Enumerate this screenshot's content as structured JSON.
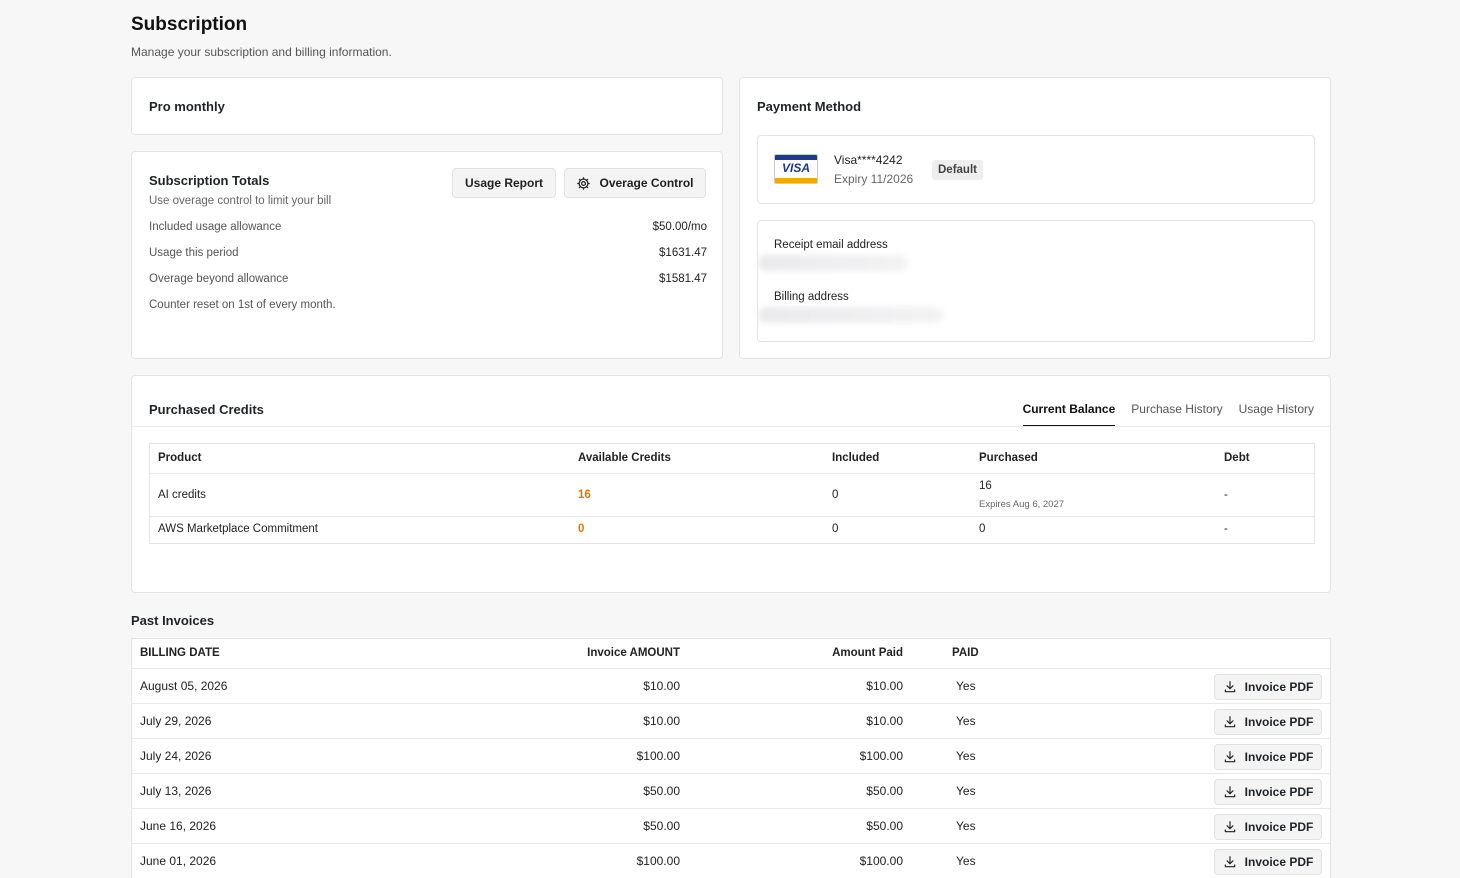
{
  "header": {
    "title": "Subscription",
    "subtitle": "Manage your subscription and billing information."
  },
  "plan": {
    "name": "Pro monthly"
  },
  "totals": {
    "title": "Subscription Totals",
    "subtitle": "Use overage control to limit your bill",
    "usage_report_label": "Usage Report",
    "overage_control_label": "Overage Control",
    "rows": [
      {
        "label": "Included usage allowance",
        "value": "$50.00/mo"
      },
      {
        "label": "Usage this period",
        "value": "$1631.47"
      },
      {
        "label": "Overage beyond allowance",
        "value": "$1581.47"
      }
    ],
    "reset_note": "Counter reset on 1st of every month."
  },
  "payment": {
    "title": "Payment Method",
    "card_brand": "VISA",
    "card_number": "Visa****4242",
    "card_expiry": "Expiry 11/2026",
    "default_badge": "Default",
    "receipt_label": "Receipt email address",
    "billing_label": "Billing address"
  },
  "credits": {
    "title": "Purchased Credits",
    "tabs": [
      "Current Balance",
      "Purchase History",
      "Usage History"
    ],
    "columns": [
      "Product",
      "Available Credits",
      "Included",
      "Purchased",
      "Debt"
    ],
    "rows": [
      {
        "product": "AI credits",
        "available": "16",
        "included": "0",
        "purchased": "16",
        "purchased_note": "Expires Aug 6, 2027",
        "debt": "-"
      },
      {
        "product": "AWS Marketplace Commitment",
        "available": "0",
        "included": "0",
        "purchased": "0",
        "purchased_note": "",
        "debt": "-"
      }
    ]
  },
  "invoices": {
    "title": "Past Invoices",
    "columns": [
      "BILLING DATE",
      "Invoice AMOUNT",
      "Amount Paid",
      "PAID"
    ],
    "pdf_label": "Invoice PDF",
    "rows": [
      {
        "date": "August 05, 2026",
        "amount": "$10.00",
        "paid_amount": "$10.00",
        "paid": "Yes"
      },
      {
        "date": "July 29, 2026",
        "amount": "$10.00",
        "paid_amount": "$10.00",
        "paid": "Yes"
      },
      {
        "date": "July 24, 2026",
        "amount": "$100.00",
        "paid_amount": "$100.00",
        "paid": "Yes"
      },
      {
        "date": "July 13, 2026",
        "amount": "$50.00",
        "paid_amount": "$50.00",
        "paid": "Yes"
      },
      {
        "date": "June 16, 2026",
        "amount": "$50.00",
        "paid_amount": "$50.00",
        "paid": "Yes"
      },
      {
        "date": "June 01, 2026",
        "amount": "$100.00",
        "paid_amount": "$100.00",
        "paid": "Yes"
      }
    ]
  },
  "colors": {
    "accent_orange": "#d97706",
    "visa_blue": "#1a3a8f",
    "visa_gold": "#f2a900"
  }
}
